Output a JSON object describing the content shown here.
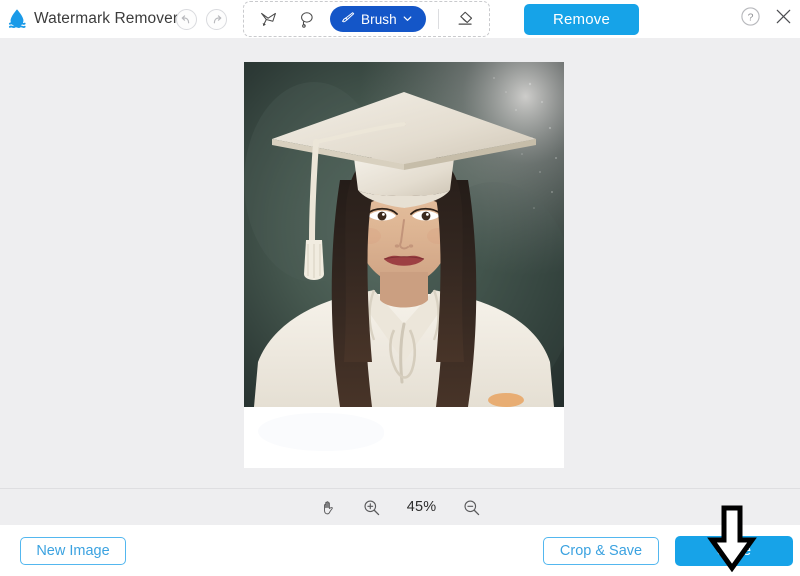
{
  "app": {
    "title": "Watermark Remover",
    "logo_icon": "water-drop-icon",
    "accent_blue": "#16a3e8",
    "brush_blue": "#1456c8",
    "outline_blue": "#53b7ef",
    "canvas_bg": "#eeeef0"
  },
  "header": {
    "undo_icon": "undo-arrow-icon",
    "redo_icon": "redo-arrow-icon",
    "tools": [
      {
        "name": "polygonal-lasso-tool",
        "icon": "polygonal-lasso-icon",
        "selected": false
      },
      {
        "name": "lasso-tool",
        "icon": "lasso-icon",
        "selected": false
      }
    ],
    "brush": {
      "label": "Brush",
      "icon": "paintbrush-icon",
      "chevron": "chevron-down-icon",
      "selected": true
    },
    "eraser": {
      "name": "eraser-tool",
      "icon": "eraser-icon",
      "selected": false
    },
    "remove_label": "Remove",
    "help_icon": "question-mark-circle-icon",
    "close_icon": "close-x-icon"
  },
  "canvas": {
    "photo_alt": "graduation-portrait-photo",
    "erased_region_note": "watermark-removed-white-strip"
  },
  "zoombar": {
    "pan_icon": "hand-pan-icon",
    "zoom_in_icon": "magnifier-plus-icon",
    "zoom_out_icon": "magnifier-minus-icon",
    "zoom_level": "45%"
  },
  "footer": {
    "new_image_label": "New Image",
    "crop_save_label": "Crop & Save",
    "save_label": "Save"
  },
  "annotation": {
    "arrow_icon": "down-arrow-annotation",
    "points_at": "save-button"
  }
}
